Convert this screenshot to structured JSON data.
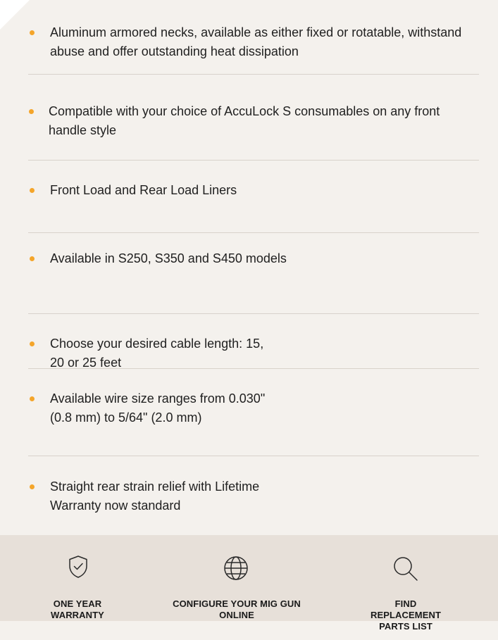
{
  "features": [
    {
      "text": "Aluminum armored necks, available as either fixed or rotatable, withstand abuse and offer outstanding heat dissipation"
    },
    {
      "text": "Compatible with your choice of AccuLock S consumables on any front handle style"
    },
    {
      "text": "Front Load and Rear Load Liners"
    },
    {
      "text": "Available in S250, S350 and S450 models"
    },
    {
      "text": "Choose your desired cable length: 15, 20 or 25 feet"
    },
    {
      "text": "Available wire size ranges from 0.030\" (0.8 mm) to 5/64\" (2.0 mm)"
    },
    {
      "text": "Straight rear strain relief with Lifetime Warranty now standard"
    }
  ],
  "footer": {
    "items": [
      {
        "icon": "shield-check-icon",
        "label": "ONE YEAR WARRANTY"
      },
      {
        "icon": "globe-icon",
        "label": "CONFIGURE YOUR MIG GUN ONLINE"
      },
      {
        "icon": "search-icon",
        "label": "FIND REPLACEMENT PARTS LIST"
      }
    ]
  },
  "colors": {
    "panel_background": "#f4f1ed",
    "footer_background": "#e7e0d9",
    "bullet": "#f4a52a",
    "divider": "#d8d2cb",
    "text": "#1f1f1f"
  }
}
